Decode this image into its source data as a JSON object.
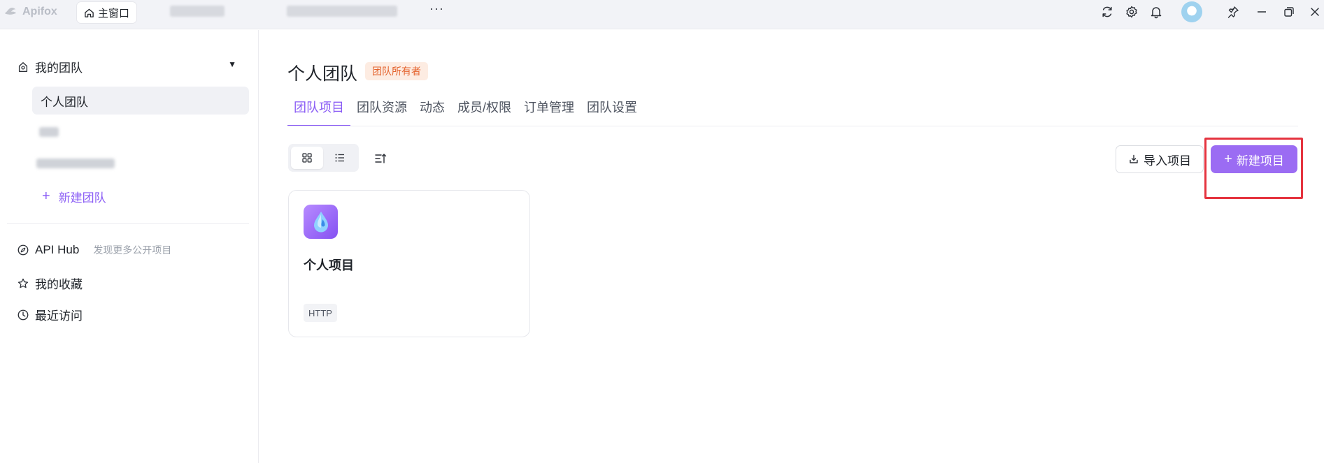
{
  "app": {
    "name": "Apifox"
  },
  "titlebar": {
    "main_tab_label": "主窗口",
    "more_label": "···",
    "icons": [
      "refresh-icon",
      "settings-icon",
      "bell-icon",
      "avatar",
      "pin-icon",
      "minimize-icon",
      "restore-icon",
      "close-icon"
    ]
  },
  "sidebar": {
    "team_header": "我的团队",
    "active_team": "个人团队",
    "new_team": "新建团队",
    "api_hub": {
      "label": "API Hub",
      "sub": "发现更多公开项目"
    },
    "favorites": "我的收藏",
    "recent": "最近访问"
  },
  "main": {
    "title": "个人团队",
    "badge": "团队所有者",
    "tabs": [
      {
        "label": "团队项目",
        "active": true
      },
      {
        "label": "团队资源",
        "active": false
      },
      {
        "label": "动态",
        "active": false
      },
      {
        "label": "成员/权限",
        "active": false
      },
      {
        "label": "订单管理",
        "active": false
      },
      {
        "label": "团队设置",
        "active": false
      }
    ],
    "import_label": "导入项目",
    "new_project_label": "新建项目",
    "projects": [
      {
        "name": "个人项目",
        "tag": "HTTP"
      }
    ]
  },
  "colors": {
    "accent": "#8a5cf5",
    "button_primary": "#9b6cf3",
    "highlight": "#e5343f",
    "badge_bg": "#fdece2",
    "badge_text": "#e4622c"
  }
}
